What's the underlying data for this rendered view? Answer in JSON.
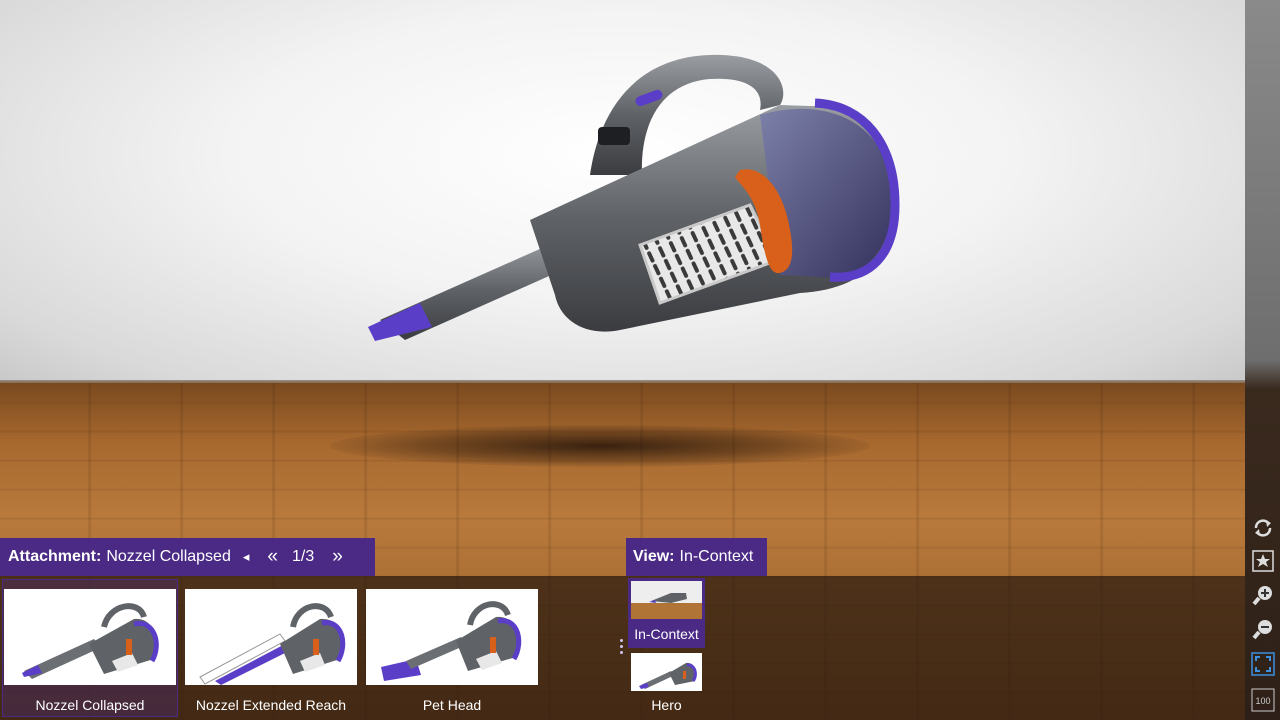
{
  "attachment_panel": {
    "label": "Attachment:",
    "value": "Nozzel Collapsed",
    "prev_single": "◂",
    "prev_double": "«",
    "pager": "1/3",
    "next_double": "»",
    "items": [
      {
        "label": "Nozzel Collapsed",
        "selected": true
      },
      {
        "label": "Nozzel Extended Reach",
        "selected": false
      },
      {
        "label": "Pet Head",
        "selected": false
      }
    ]
  },
  "view_panel": {
    "label": "View:",
    "value": "In-Context",
    "items": [
      {
        "label": "In-Context",
        "selected": true
      },
      {
        "label": "Hero",
        "selected": false
      }
    ]
  },
  "toolbar": {
    "buttons": [
      {
        "name": "rotate-icon"
      },
      {
        "name": "favorite-icon"
      },
      {
        "name": "zoom-in-icon"
      },
      {
        "name": "zoom-out-icon"
      },
      {
        "name": "fullscreen-icon"
      },
      {
        "name": "zoom-100-icon",
        "text": "100"
      }
    ]
  },
  "colors": {
    "accent_purple": "#4a2a85",
    "product_purple": "#5a3ec8",
    "product_orange": "#d9601a",
    "product_gray": "#6b6e72"
  }
}
